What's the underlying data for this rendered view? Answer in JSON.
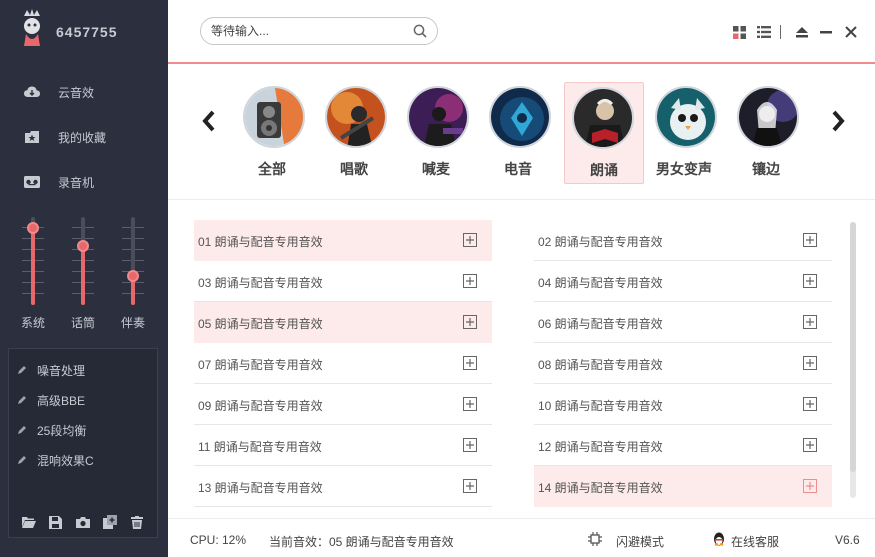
{
  "app": {
    "user_id": "6457755"
  },
  "sidebar": {
    "nav": [
      {
        "label": "云音效",
        "icon": "cloud-icon"
      },
      {
        "label": "我的收藏",
        "icon": "favorites-folder-icon"
      },
      {
        "label": "录音机",
        "icon": "recorder-icon"
      }
    ],
    "faders": [
      {
        "label": "系统",
        "level": 0.92
      },
      {
        "label": "话筒",
        "level": 0.7
      },
      {
        "label": "伴奏",
        "level": 0.35
      }
    ],
    "effects": [
      {
        "label": "噪音处理",
        "icon": "pen-icon"
      },
      {
        "label": "高级BBE",
        "icon": "pen-icon"
      },
      {
        "label": "25段均衡",
        "icon": "pen-icon"
      },
      {
        "label": "混响效果C",
        "icon": "pen-icon"
      }
    ],
    "effect_tools": [
      "open-folder-icon",
      "save-icon",
      "camera-icon",
      "copy-add-icon",
      "trash-icon"
    ]
  },
  "search": {
    "placeholder": "等待输入..."
  },
  "window_controls": [
    "grid-view-icon",
    "list-view-icon",
    "eject-icon",
    "minimize-icon",
    "close-icon"
  ],
  "categories": [
    {
      "label": "全部",
      "active": false
    },
    {
      "label": "唱歌",
      "active": false
    },
    {
      "label": "喊麦",
      "active": false
    },
    {
      "label": "电音",
      "active": false
    },
    {
      "label": "朗诵",
      "active": true
    },
    {
      "label": "男女变声",
      "active": false
    },
    {
      "label": "镶边",
      "active": false
    }
  ],
  "effects_list": [
    "01 朗诵与配音专用音效",
    "02 朗诵与配音专用音效",
    "03 朗诵与配音专用音效",
    "04 朗诵与配音专用音效",
    "05 朗诵与配音专用音效",
    "06 朗诵与配音专用音效",
    "07 朗诵与配音专用音效",
    "08 朗诵与配音专用音效",
    "09 朗诵与配音专用音效",
    "10 朗诵与配音专用音效",
    "11 朗诵与配音专用音效",
    "12 朗诵与配音专用音效",
    "13 朗诵与配音专用音效",
    "14 朗诵与配音专用音效"
  ],
  "status": {
    "cpu": "CPU: 12%",
    "current": "当前音效：05 朗诵与配音专用音效",
    "flash_mode": "闪避模式",
    "online_service": "在线客服",
    "version": "V6.6"
  },
  "colors": {
    "accent": "#e8686a",
    "sidebar_bg": "#2b2f3e",
    "highlight_row": "#fdeaea"
  }
}
